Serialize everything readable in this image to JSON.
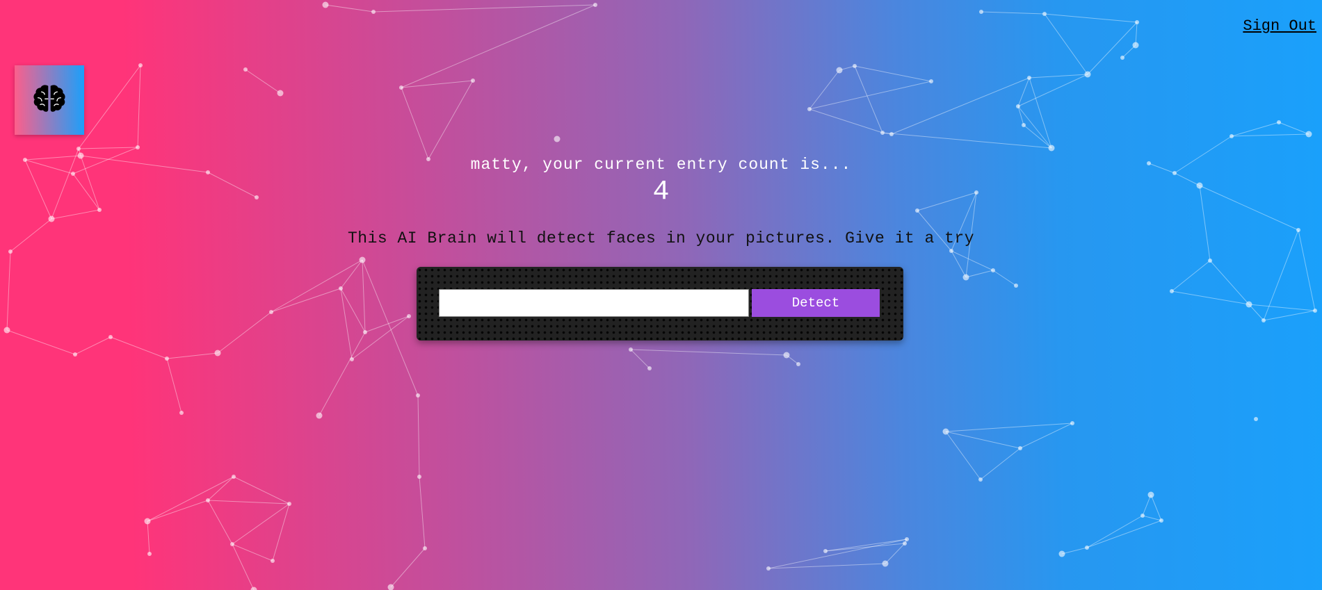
{
  "nav": {
    "sign_out_label": "Sign Out"
  },
  "logo": {
    "icon": "brain-icon"
  },
  "rank": {
    "message": "matty, your current entry count is...",
    "count": "4"
  },
  "instruction": "This AI Brain will detect faces in your pictures. Give it a try",
  "form": {
    "input_value": "",
    "detect_label": "Detect"
  },
  "colors": {
    "gradient_left": "#ff3479",
    "gradient_right": "#1aa0fb",
    "button": "#9b4ddf",
    "panel": "#222222"
  }
}
